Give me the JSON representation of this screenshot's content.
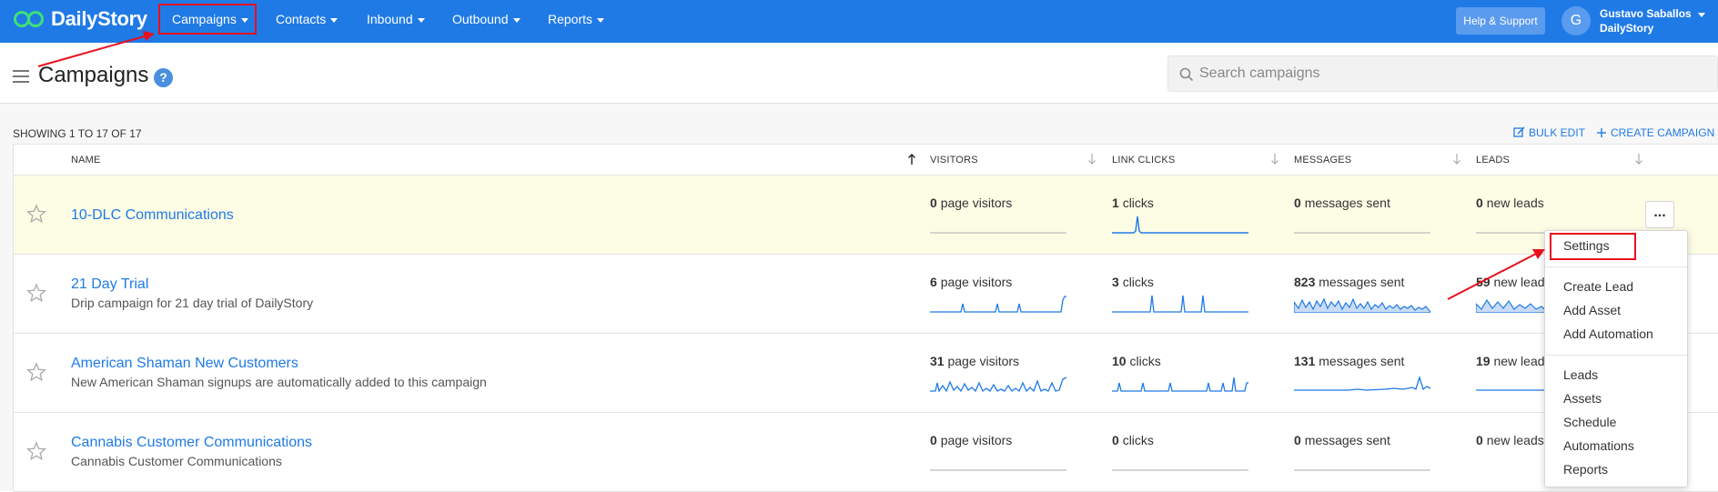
{
  "app": {
    "logo_text": "DailyStory"
  },
  "nav": [
    {
      "label": "Campaigns"
    },
    {
      "label": "Contacts"
    },
    {
      "label": "Inbound"
    },
    {
      "label": "Outbound"
    },
    {
      "label": "Reports"
    }
  ],
  "header_right": {
    "help_label": "Help & Support",
    "avatar_initial": "G",
    "user_name": "Gustavo Saballos",
    "user_org": "DailyStory"
  },
  "page": {
    "title": "Campaigns",
    "help_icon": "?"
  },
  "search": {
    "placeholder": "Search campaigns",
    "value": ""
  },
  "toolbar": {
    "showing": "SHOWING 1 TO 17 OF 17",
    "bulk_edit": "BULK EDIT",
    "create_campaign": "CREATE CAMPAIGN"
  },
  "table": {
    "columns": [
      "NAME",
      "VISITORS",
      "LINK CLICKS",
      "MESSAGES",
      "LEADS"
    ],
    "rows": [
      {
        "name": "10-DLC Communications",
        "description": "",
        "visitors_count": "0",
        "visitors_label": "page visitors",
        "clicks_count": "1",
        "clicks_label": "clicks",
        "messages_count": "0",
        "messages_label": "messages sent",
        "leads_count": "0",
        "leads_label": "new leads"
      },
      {
        "name": "21 Day Trial",
        "description": "Drip campaign for 21 day trial of DailyStory",
        "visitors_count": "6",
        "visitors_label": "page visitors",
        "clicks_count": "3",
        "clicks_label": "clicks",
        "messages_count": "823",
        "messages_label": "messages sent",
        "leads_count": "59",
        "leads_label": "new leads"
      },
      {
        "name": "American Shaman New Customers",
        "description": "New American Shaman signups are automatically added to this campaign",
        "visitors_count": "31",
        "visitors_label": "page visitors",
        "clicks_count": "10",
        "clicks_label": "clicks",
        "messages_count": "131",
        "messages_label": "messages sent",
        "leads_count": "19",
        "leads_label": "new leads"
      },
      {
        "name": "Cannabis Customer Communications",
        "description": "Cannabis Customer Communications",
        "visitors_count": "0",
        "visitors_label": "page visitors",
        "clicks_count": "0",
        "clicks_label": "clicks",
        "messages_count": "0",
        "messages_label": "messages sent",
        "leads_count": "0",
        "leads_label": "new leads"
      }
    ]
  },
  "row_menu": {
    "button_label": "...",
    "group1": [
      "Settings"
    ],
    "group2": [
      "Create Lead",
      "Add Asset",
      "Add Automation"
    ],
    "group3": [
      "Leads",
      "Assets",
      "Schedule",
      "Automations",
      "Reports"
    ]
  },
  "colors": {
    "brand": "#1f7ae6",
    "highlight_row": "#fdfde6",
    "annotation": "#e8101e"
  }
}
